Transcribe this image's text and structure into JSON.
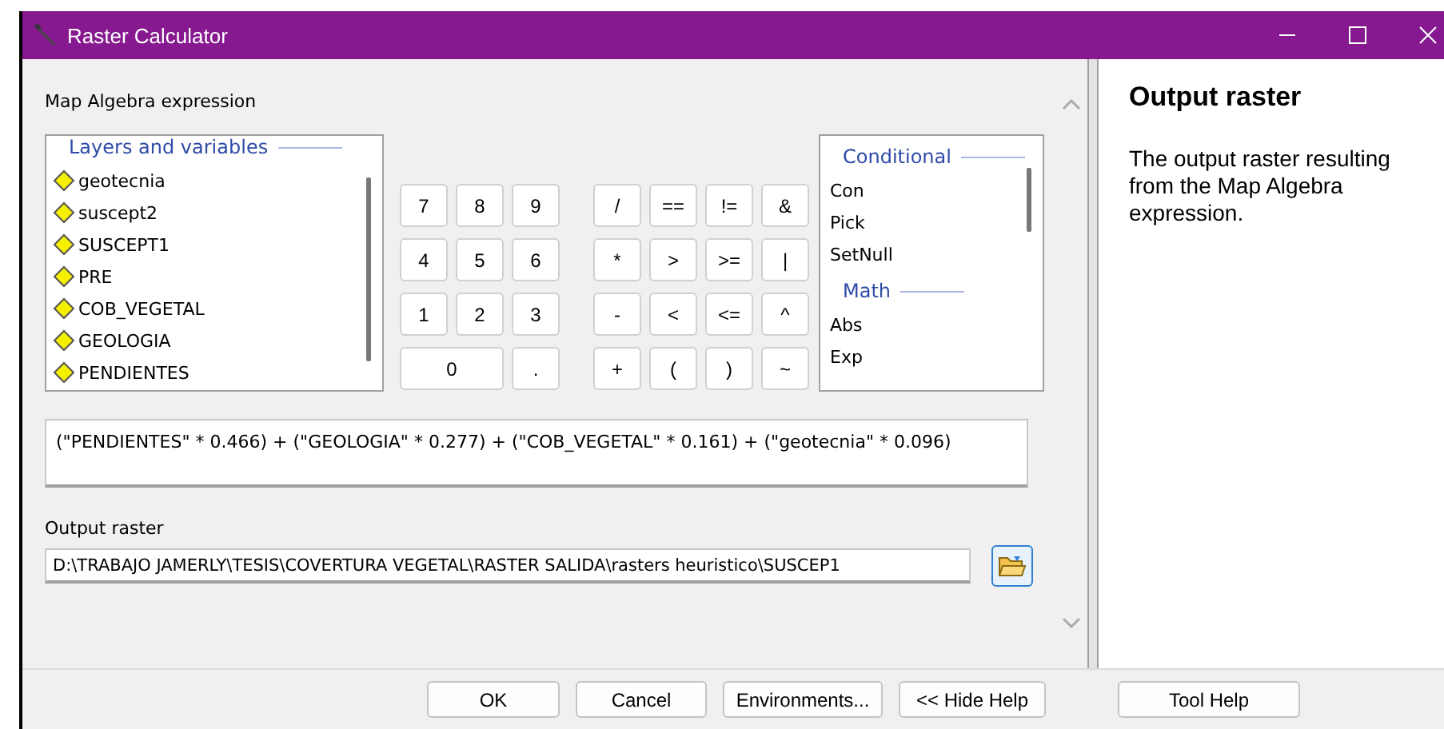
{
  "window": {
    "title": "Raster Calculator"
  },
  "expression_label": "Map Algebra expression",
  "layers": {
    "heading": "Layers and variables",
    "items": [
      "geotecnia",
      "suscept2",
      "SUSCEPT1",
      "PRE",
      "COB_VEGETAL",
      "GEOLOGIA",
      "PENDIENTES"
    ]
  },
  "keypad": [
    [
      "7",
      "8",
      "9",
      "/",
      "==",
      "!=",
      "&"
    ],
    [
      "4",
      "5",
      "6",
      "*",
      ">",
      ">=",
      "|"
    ],
    [
      "1",
      "2",
      "3",
      "-",
      "<",
      "<=",
      "^"
    ],
    [
      "0",
      ".",
      "+",
      "(",
      ")",
      "~"
    ]
  ],
  "functions": {
    "groups": [
      {
        "heading": "Conditional",
        "items": [
          "Con",
          "Pick",
          "SetNull"
        ]
      },
      {
        "heading": "Math",
        "items": [
          "Abs",
          "Exp"
        ]
      }
    ]
  },
  "expression": "(\"PENDIENTES\" * 0.466) + (\"GEOLOGIA\" * 0.277) + (\"COB_VEGETAL\" * 0.161) + (\"geotecnia\" * 0.096)",
  "output": {
    "label": "Output raster",
    "value": "D:\\TRABAJO JAMERLY\\TESIS\\COVERTURA VEGETAL\\RASTER SALIDA\\rasters heuristico\\SUSCEP1"
  },
  "buttons": [
    "OK",
    "Cancel",
    "Environments...",
    "<< Hide Help",
    "Tool Help"
  ],
  "help": {
    "title": "Output raster",
    "text": "The output raster resulting from the Map Algebra expression."
  }
}
